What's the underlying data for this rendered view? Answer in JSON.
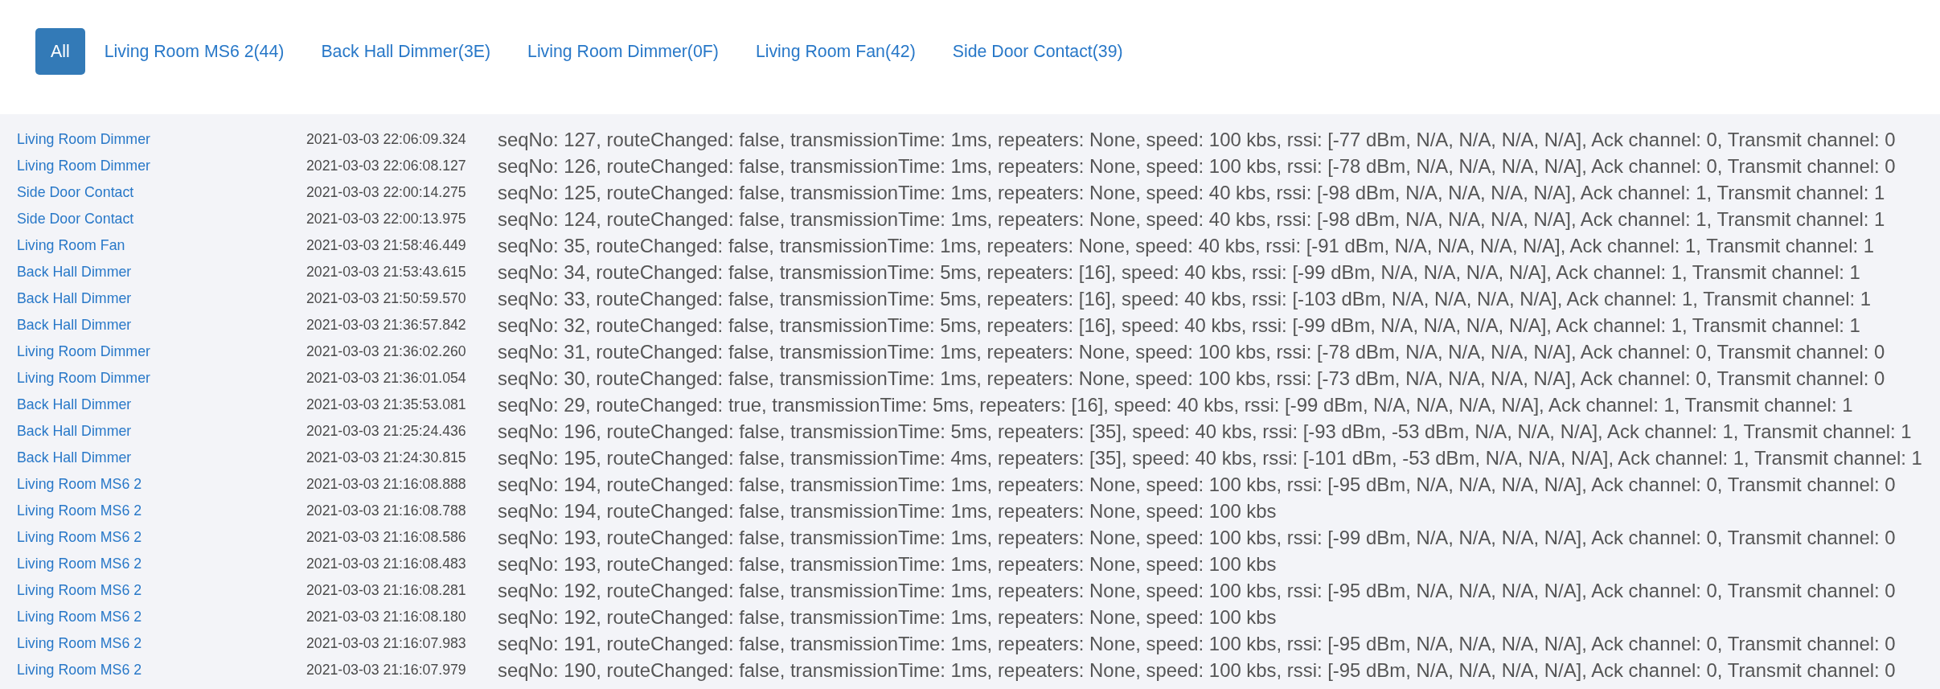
{
  "tabs": [
    {
      "label": "All",
      "selected": true
    },
    {
      "label": "Living Room MS6 2(44)",
      "selected": false
    },
    {
      "label": "Back Hall Dimmer(3E)",
      "selected": false
    },
    {
      "label": "Living Room Dimmer(0F)",
      "selected": false
    },
    {
      "label": "Living Room Fan(42)",
      "selected": false
    },
    {
      "label": "Side Door Contact(39)",
      "selected": false
    }
  ],
  "log": [
    {
      "device": "Living Room Dimmer",
      "time": "2021-03-03 22:06:09.324",
      "message": "seqNo: 127, routeChanged: false, transmissionTime: 1ms, repeaters: None, speed: 100 kbs, rssi: [-77 dBm, N/A, N/A, N/A, N/A], Ack channel: 0, Transmit channel: 0"
    },
    {
      "device": "Living Room Dimmer",
      "time": "2021-03-03 22:06:08.127",
      "message": "seqNo: 126, routeChanged: false, transmissionTime: 1ms, repeaters: None, speed: 100 kbs, rssi: [-78 dBm, N/A, N/A, N/A, N/A], Ack channel: 0, Transmit channel: 0"
    },
    {
      "device": "Side Door Contact",
      "time": "2021-03-03 22:00:14.275",
      "message": "seqNo: 125, routeChanged: false, transmissionTime: 1ms, repeaters: None, speed: 40 kbs, rssi: [-98 dBm, N/A, N/A, N/A, N/A], Ack channel: 1, Transmit channel: 1"
    },
    {
      "device": "Side Door Contact",
      "time": "2021-03-03 22:00:13.975",
      "message": "seqNo: 124, routeChanged: false, transmissionTime: 1ms, repeaters: None, speed: 40 kbs, rssi: [-98 dBm, N/A, N/A, N/A, N/A], Ack channel: 1, Transmit channel: 1"
    },
    {
      "device": "Living Room Fan",
      "time": "2021-03-03 21:58:46.449",
      "message": "seqNo: 35, routeChanged: false, transmissionTime: 1ms, repeaters: None, speed: 40 kbs, rssi: [-91 dBm, N/A, N/A, N/A, N/A], Ack channel: 1, Transmit channel: 1"
    },
    {
      "device": "Back Hall Dimmer",
      "time": "2021-03-03 21:53:43.615",
      "message": "seqNo: 34, routeChanged: false, transmissionTime: 5ms, repeaters: [16], speed: 40 kbs, rssi: [-99 dBm, N/A, N/A, N/A, N/A], Ack channel: 1, Transmit channel: 1"
    },
    {
      "device": "Back Hall Dimmer",
      "time": "2021-03-03 21:50:59.570",
      "message": "seqNo: 33, routeChanged: false, transmissionTime: 5ms, repeaters: [16], speed: 40 kbs, rssi: [-103 dBm, N/A, N/A, N/A, N/A], Ack channel: 1, Transmit channel: 1"
    },
    {
      "device": "Back Hall Dimmer",
      "time": "2021-03-03 21:36:57.842",
      "message": "seqNo: 32, routeChanged: false, transmissionTime: 5ms, repeaters: [16], speed: 40 kbs, rssi: [-99 dBm, N/A, N/A, N/A, N/A], Ack channel: 1, Transmit channel: 1"
    },
    {
      "device": "Living Room Dimmer",
      "time": "2021-03-03 21:36:02.260",
      "message": "seqNo: 31, routeChanged: false, transmissionTime: 1ms, repeaters: None, speed: 100 kbs, rssi: [-78 dBm, N/A, N/A, N/A, N/A], Ack channel: 0, Transmit channel: 0"
    },
    {
      "device": "Living Room Dimmer",
      "time": "2021-03-03 21:36:01.054",
      "message": "seqNo: 30, routeChanged: false, transmissionTime: 1ms, repeaters: None, speed: 100 kbs, rssi: [-73 dBm, N/A, N/A, N/A, N/A], Ack channel: 0, Transmit channel: 0"
    },
    {
      "device": "Back Hall Dimmer",
      "time": "2021-03-03 21:35:53.081",
      "message": "seqNo: 29, routeChanged: true, transmissionTime: 5ms, repeaters: [16], speed: 40 kbs, rssi: [-99 dBm, N/A, N/A, N/A, N/A], Ack channel: 1, Transmit channel: 1"
    },
    {
      "device": "Back Hall Dimmer",
      "time": "2021-03-03 21:25:24.436",
      "message": "seqNo: 196, routeChanged: false, transmissionTime: 5ms, repeaters: [35], speed: 40 kbs, rssi: [-93 dBm, -53 dBm, N/A, N/A, N/A], Ack channel: 1, Transmit channel: 1"
    },
    {
      "device": "Back Hall Dimmer",
      "time": "2021-03-03 21:24:30.815",
      "message": "seqNo: 195, routeChanged: false, transmissionTime: 4ms, repeaters: [35], speed: 40 kbs, rssi: [-101 dBm, -53 dBm, N/A, N/A, N/A], Ack channel: 1, Transmit channel: 1"
    },
    {
      "device": "Living Room MS6 2",
      "time": "2021-03-03 21:16:08.888",
      "message": "seqNo: 194, routeChanged: false, transmissionTime: 1ms, repeaters: None, speed: 100 kbs, rssi: [-95 dBm, N/A, N/A, N/A, N/A], Ack channel: 0, Transmit channel: 0"
    },
    {
      "device": "Living Room MS6 2",
      "time": "2021-03-03 21:16:08.788",
      "message": "seqNo: 194, routeChanged: false, transmissionTime: 1ms, repeaters: None, speed: 100 kbs"
    },
    {
      "device": "Living Room MS6 2",
      "time": "2021-03-03 21:16:08.586",
      "message": "seqNo: 193, routeChanged: false, transmissionTime: 1ms, repeaters: None, speed: 100 kbs, rssi: [-99 dBm, N/A, N/A, N/A, N/A], Ack channel: 0, Transmit channel: 0"
    },
    {
      "device": "Living Room MS6 2",
      "time": "2021-03-03 21:16:08.483",
      "message": "seqNo: 193, routeChanged: false, transmissionTime: 1ms, repeaters: None, speed: 100 kbs"
    },
    {
      "device": "Living Room MS6 2",
      "time": "2021-03-03 21:16:08.281",
      "message": "seqNo: 192, routeChanged: false, transmissionTime: 1ms, repeaters: None, speed: 100 kbs, rssi: [-95 dBm, N/A, N/A, N/A, N/A], Ack channel: 0, Transmit channel: 0"
    },
    {
      "device": "Living Room MS6 2",
      "time": "2021-03-03 21:16:08.180",
      "message": "seqNo: 192, routeChanged: false, transmissionTime: 1ms, repeaters: None, speed: 100 kbs"
    },
    {
      "device": "Living Room MS6 2",
      "time": "2021-03-03 21:16:07.983",
      "message": "seqNo: 191, routeChanged: false, transmissionTime: 1ms, repeaters: None, speed: 100 kbs, rssi: [-95 dBm, N/A, N/A, N/A, N/A], Ack channel: 0, Transmit channel: 0"
    },
    {
      "device": "Living Room MS6 2",
      "time": "2021-03-03 21:16:07.979",
      "message": "seqNo: 190, routeChanged: false, transmissionTime: 1ms, repeaters: None, speed: 100 kbs, rssi: [-95 dBm, N/A, N/A, N/A, N/A], Ack channel: 0, Transmit channel: 0"
    }
  ]
}
